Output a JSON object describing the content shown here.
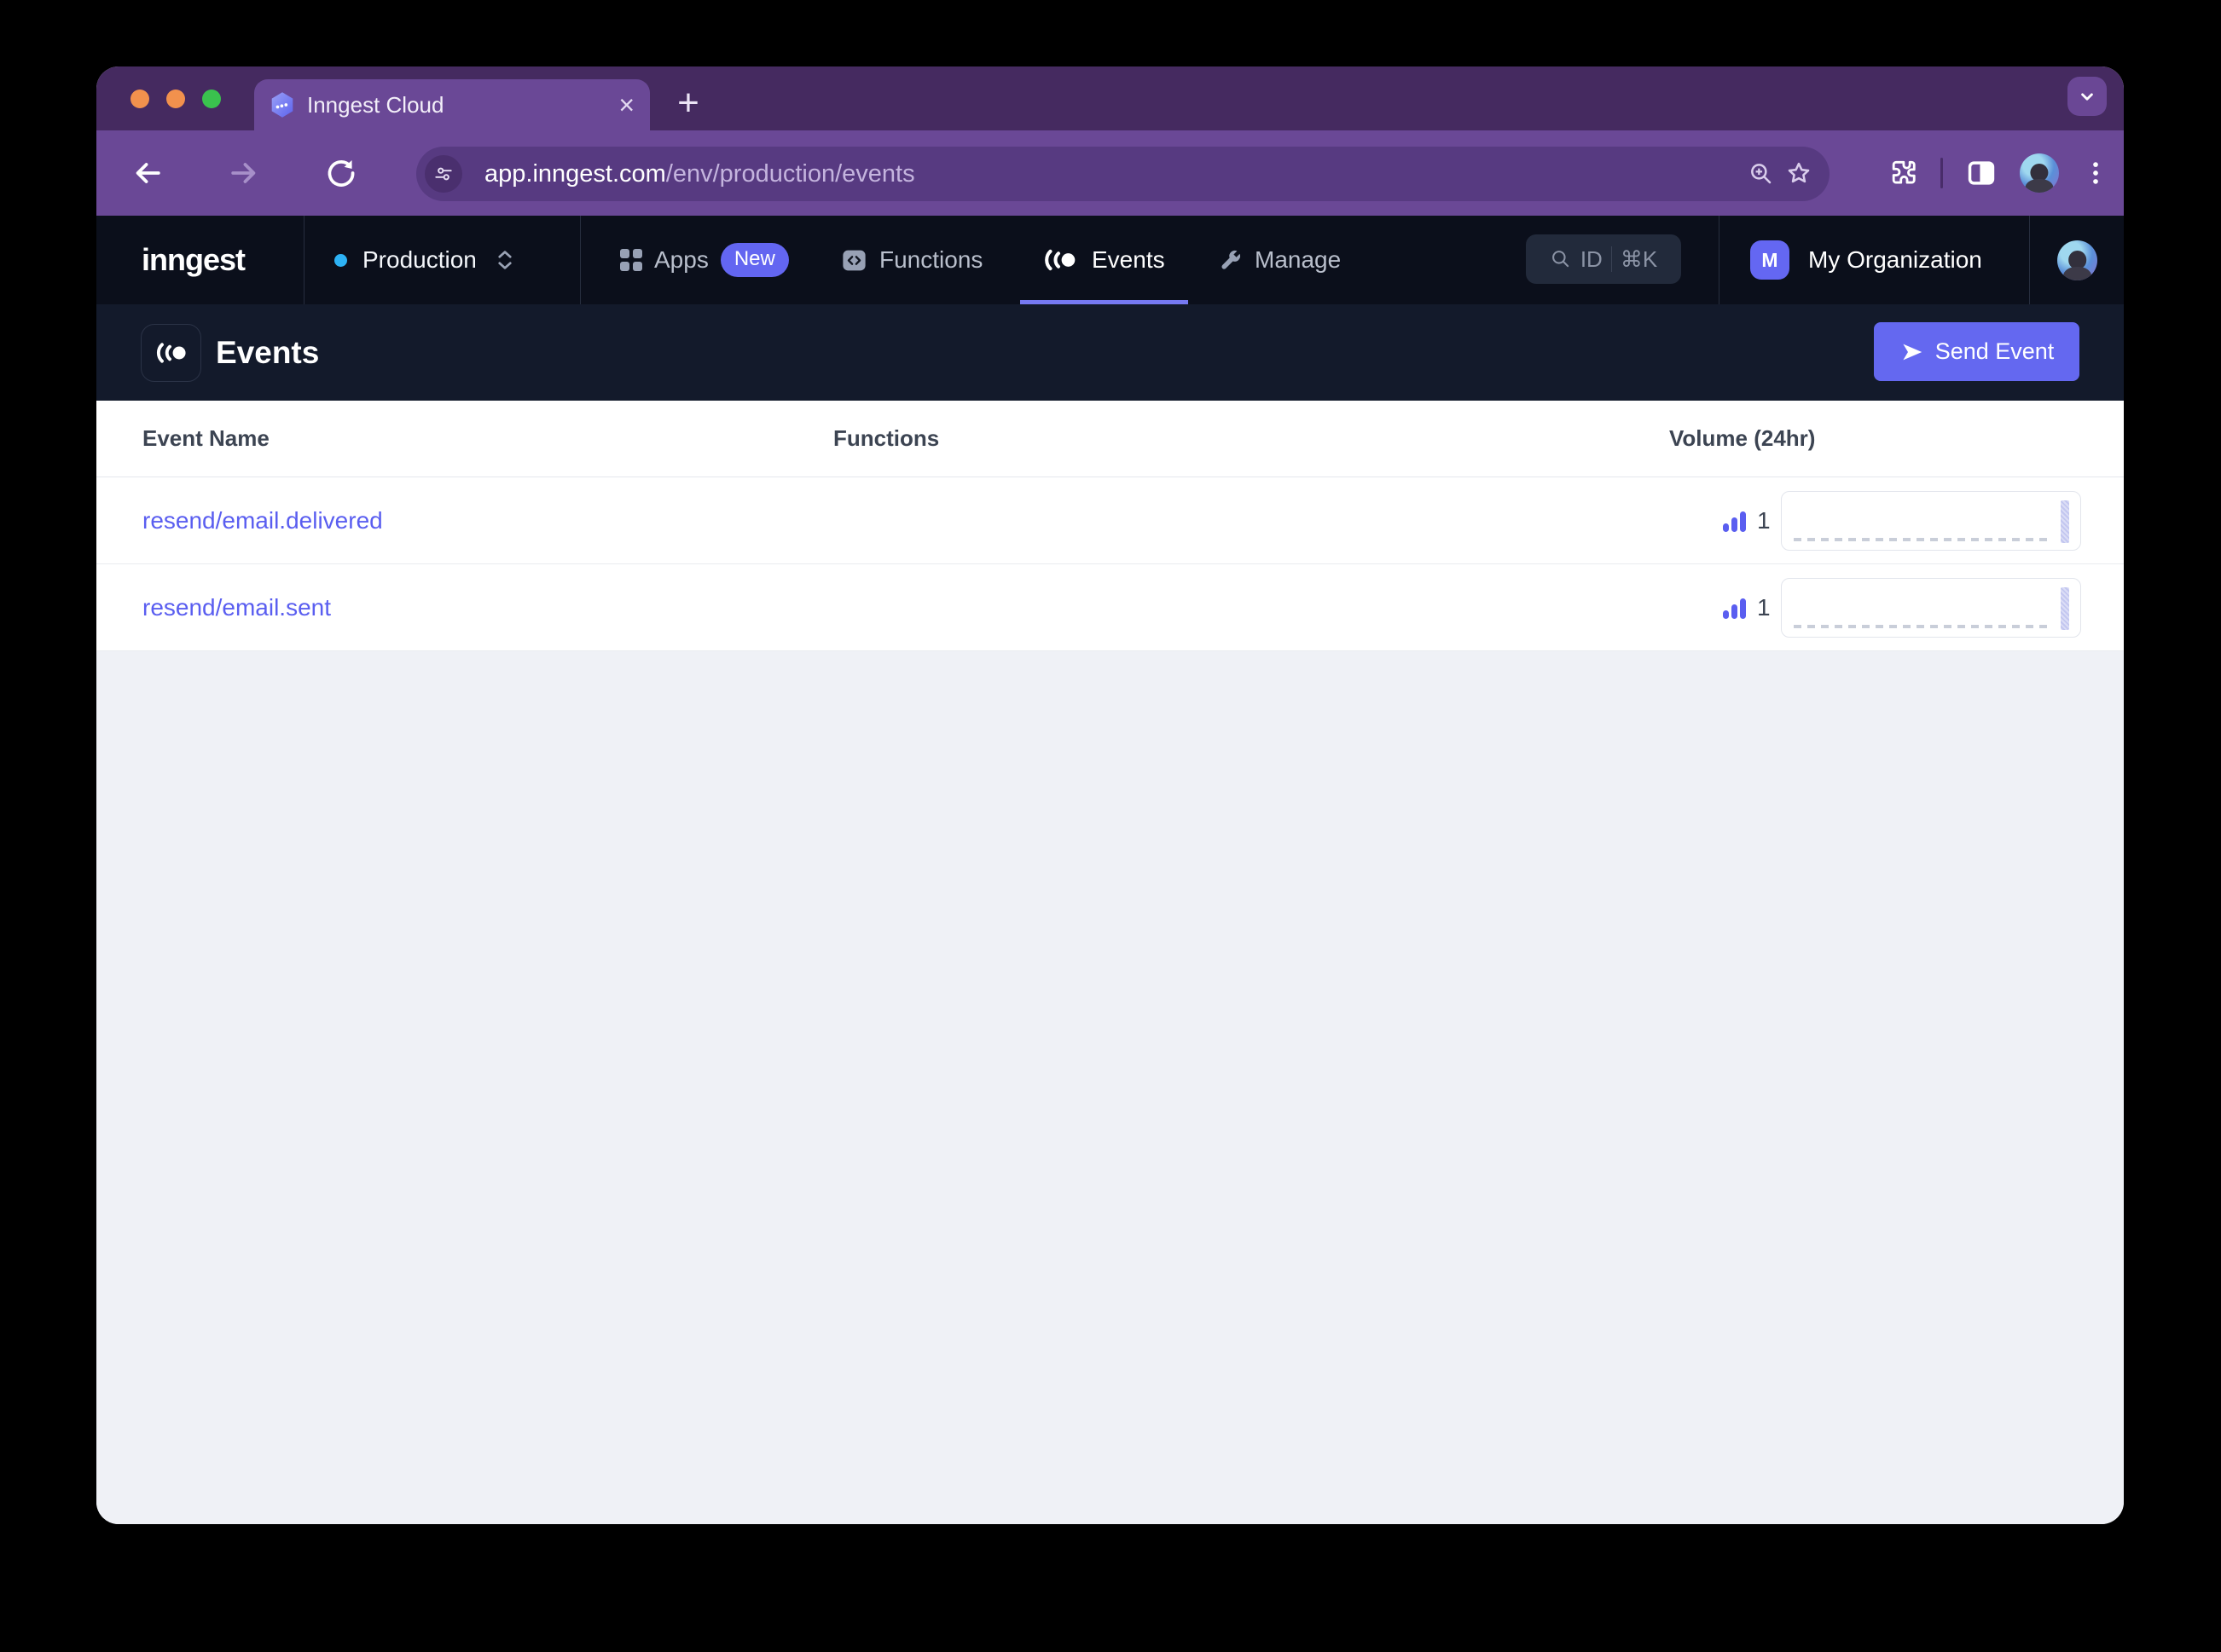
{
  "colors": {
    "accent": "#6366f1",
    "link": "#5a5ef0",
    "tab_underline": "#7679f2",
    "send_button": "#6468f0",
    "env_dot": "#2db2f5",
    "traffic_lights": [
      "#f2914d",
      "#f2914d",
      "#3ac24e"
    ]
  },
  "browser": {
    "tab_title": "Inngest Cloud",
    "tab_close": "×",
    "new_tab": "+",
    "url_domain": "app.inngest.com",
    "url_path": "/env/production/events"
  },
  "nav": {
    "logo": "inngest",
    "environment": "Production",
    "apps_label": "Apps",
    "apps_badge": "New",
    "functions_label": "Functions",
    "events_label": "Events",
    "manage_label": "Manage",
    "search_label": "ID",
    "search_shortcut": "⌘K",
    "org_initial": "M",
    "org_name": "My Organization"
  },
  "page": {
    "title": "Events",
    "send_event": "Send Event"
  },
  "table": {
    "columns": [
      "Event Name",
      "Functions",
      "Volume (24hr)"
    ],
    "rows": [
      {
        "name": "resend/email.delivered",
        "functions": "",
        "volume": "1",
        "sparkline_24hr": [
          0,
          0,
          0,
          0,
          0,
          0,
          0,
          0,
          0,
          0,
          0,
          0,
          0,
          0,
          0,
          0,
          0,
          0,
          0,
          0,
          0,
          0,
          0,
          0,
          1
        ]
      },
      {
        "name": "resend/email.sent",
        "functions": "",
        "volume": "1",
        "sparkline_24hr": [
          0,
          0,
          0,
          0,
          0,
          0,
          0,
          0,
          0,
          0,
          0,
          0,
          0,
          0,
          0,
          0,
          0,
          0,
          0,
          0,
          0,
          0,
          0,
          0,
          1
        ]
      }
    ]
  }
}
